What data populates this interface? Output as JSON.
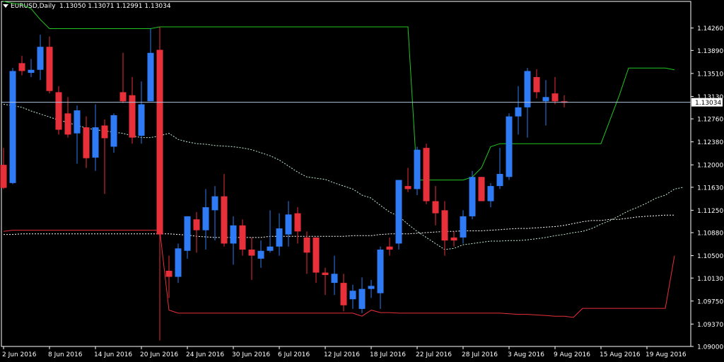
{
  "header": {
    "symbol": "EURUSD,Daily",
    "ohlc": "1.13050 1.13071 1.12991 1.13034"
  },
  "colors": {
    "background": "#000000",
    "bull": "#2f7bf5",
    "bear": "#e8303a",
    "upper_band": "#21c521",
    "lower_band": "#e8303a",
    "ma_long": "#ffffff",
    "ma_short": "#c8f0d8",
    "frame": "#ffffff",
    "current_price_line": "#b0c4de"
  },
  "chart_data": {
    "type": "candlestick",
    "title": "",
    "ylim": [
      1.09,
      1.147
    ],
    "y_ticks": [
      "1.14260",
      "1.13890",
      "1.13510",
      "1.13130",
      "1.12760",
      "1.12380",
      "1.12000",
      "1.11630",
      "1.11250",
      "1.10880",
      "1.10500",
      "1.10130",
      "1.09750",
      "1.09370",
      "1.09000"
    ],
    "current_price_label": "1.13034",
    "current_price": 1.13034,
    "x_labels": [
      {
        "bar": 0,
        "label": "2 Jun 2016"
      },
      {
        "bar": 5,
        "label": "8 Jun 2016"
      },
      {
        "bar": 10,
        "label": "14 Jun 2016"
      },
      {
        "bar": 15,
        "label": "20 Jun 2016"
      },
      {
        "bar": 20,
        "label": "24 Jun 2016"
      },
      {
        "bar": 25,
        "label": "30 Jun 2016"
      },
      {
        "bar": 30,
        "label": "6 Jul 2016"
      },
      {
        "bar": 35,
        "label": "12 Jul 2016"
      },
      {
        "bar": 40,
        "label": "18 Jul 2016"
      },
      {
        "bar": 45,
        "label": "22 Jul 2016"
      },
      {
        "bar": 50,
        "label": "28 Jul 2016"
      },
      {
        "bar": 55,
        "label": "3 Aug 2016"
      },
      {
        "bar": 60,
        "label": "9 Aug 2016"
      },
      {
        "bar": 65,
        "label": "15 Aug 2016"
      },
      {
        "bar": 70,
        "label": "19 Aug 2016"
      }
    ],
    "candles": [
      {
        "o": 1.12,
        "h": 1.1228,
        "l": 1.116,
        "c": 1.1162
      },
      {
        "o": 1.117,
        "h": 1.136,
        "l": 1.1168,
        "c": 1.1355
      },
      {
        "o": 1.1368,
        "h": 1.138,
        "l": 1.1348,
        "c": 1.1355
      },
      {
        "o": 1.1352,
        "h": 1.1375,
        "l": 1.1345,
        "c": 1.1357
      },
      {
        "o": 1.1357,
        "h": 1.1415,
        "l": 1.134,
        "c": 1.1395
      },
      {
        "o": 1.1395,
        "h": 1.1412,
        "l": 1.1318,
        "c": 1.1322
      },
      {
        "o": 1.132,
        "h": 1.133,
        "l": 1.125,
        "c": 1.1258
      },
      {
        "o": 1.1285,
        "h": 1.1312,
        "l": 1.1245,
        "c": 1.125
      },
      {
        "o": 1.1252,
        "h": 1.1298,
        "l": 1.1202,
        "c": 1.129
      },
      {
        "o": 1.1262,
        "h": 1.128,
        "l": 1.1195,
        "c": 1.1211
      },
      {
        "o": 1.1212,
        "h": 1.13,
        "l": 1.119,
        "c": 1.1262
      },
      {
        "o": 1.1265,
        "h": 1.1275,
        "l": 1.1152,
        "c": 1.1244
      },
      {
        "o": 1.123,
        "h": 1.1285,
        "l": 1.122,
        "c": 1.1282
      },
      {
        "o": 1.132,
        "h": 1.1385,
        "l": 1.1302,
        "c": 1.1305
      },
      {
        "o": 1.1315,
        "h": 1.1345,
        "l": 1.1235,
        "c": 1.1245
      },
      {
        "o": 1.1248,
        "h": 1.1338,
        "l": 1.1235,
        "c": 1.13
      },
      {
        "o": 1.1305,
        "h": 1.1425,
        "l": 1.1315,
        "c": 1.1385
      },
      {
        "o": 1.139,
        "h": 1.1428,
        "l": 1.091,
        "c": 1.1085
      },
      {
        "o": 1.1025,
        "h": 1.105,
        "l": 1.098,
        "c": 1.1015
      },
      {
        "o": 1.1015,
        "h": 1.107,
        "l": 1.1005,
        "c": 1.1062
      },
      {
        "o": 1.1058,
        "h": 1.1115,
        "l": 1.1045,
        "c": 1.1115
      },
      {
        "o": 1.111,
        "h": 1.1122,
        "l": 1.1055,
        "c": 1.1092
      },
      {
        "o": 1.1092,
        "h": 1.116,
        "l": 1.106,
        "c": 1.113
      },
      {
        "o": 1.1125,
        "h": 1.1165,
        "l": 1.1075,
        "c": 1.1148
      },
      {
        "o": 1.1148,
        "h": 1.1185,
        "l": 1.1065,
        "c": 1.107
      },
      {
        "o": 1.107,
        "h": 1.1115,
        "l": 1.1035,
        "c": 1.11
      },
      {
        "o": 1.11,
        "h": 1.111,
        "l": 1.105,
        "c": 1.106
      },
      {
        "o": 1.106,
        "h": 1.108,
        "l": 1.101,
        "c": 1.105
      },
      {
        "o": 1.1045,
        "h": 1.1075,
        "l": 1.103,
        "c": 1.1058
      },
      {
        "o": 1.1058,
        "h": 1.1125,
        "l": 1.1055,
        "c": 1.1065
      },
      {
        "o": 1.1065,
        "h": 1.112,
        "l": 1.105,
        "c": 1.1095
      },
      {
        "o": 1.1085,
        "h": 1.114,
        "l": 1.1065,
        "c": 1.1118
      },
      {
        "o": 1.112,
        "h": 1.113,
        "l": 1.107,
        "c": 1.109
      },
      {
        "o": 1.108,
        "h": 1.109,
        "l": 1.102,
        "c": 1.1055
      },
      {
        "o": 1.108,
        "h": 1.108,
        "l": 1.1005,
        "c": 1.1022
      },
      {
        "o": 1.1022,
        "h": 1.103,
        "l": 1.0985,
        "c": 1.1018
      },
      {
        "o": 1.1005,
        "h": 1.105,
        "l": 1.0985,
        "c": 1.102
      },
      {
        "o": 1.1005,
        "h": 1.102,
        "l": 1.0958,
        "c": 1.0968
      },
      {
        "o": 1.0978,
        "h": 1.1002,
        "l": 1.0962,
        "c": 1.0992
      },
      {
        "o": 1.0962,
        "h": 1.1014,
        "l": 1.0955,
        "c": 1.0995
      },
      {
        "o": 1.0995,
        "h": 1.101,
        "l": 1.098,
        "c": 1.1
      },
      {
        "o": 1.0988,
        "h": 1.1065,
        "l": 1.0962,
        "c": 1.106
      },
      {
        "o": 1.1065,
        "h": 1.108,
        "l": 1.105,
        "c": 1.106
      },
      {
        "o": 1.107,
        "h": 1.1175,
        "l": 1.106,
        "c": 1.1175
      },
      {
        "o": 1.1165,
        "h": 1.1195,
        "l": 1.1155,
        "c": 1.116
      },
      {
        "o": 1.116,
        "h": 1.123,
        "l": 1.115,
        "c": 1.1225
      },
      {
        "o": 1.1228,
        "h": 1.1235,
        "l": 1.1135,
        "c": 1.114
      },
      {
        "o": 1.114,
        "h": 1.1165,
        "l": 1.11,
        "c": 1.112
      },
      {
        "o": 1.1125,
        "h": 1.114,
        "l": 1.105,
        "c": 1.1075
      },
      {
        "o": 1.108,
        "h": 1.109,
        "l": 1.1065,
        "c": 1.1075
      },
      {
        "o": 1.108,
        "h": 1.1125,
        "l": 1.107,
        "c": 1.1115
      },
      {
        "o": 1.1115,
        "h": 1.119,
        "l": 1.111,
        "c": 1.118
      },
      {
        "o": 1.118,
        "h": 1.118,
        "l": 1.114,
        "c": 1.114
      },
      {
        "o": 1.114,
        "h": 1.117,
        "l": 1.113,
        "c": 1.1165
      },
      {
        "o": 1.1165,
        "h": 1.1228,
        "l": 1.116,
        "c": 1.1185
      },
      {
        "o": 1.118,
        "h": 1.1285,
        "l": 1.1175,
        "c": 1.128
      },
      {
        "o": 1.128,
        "h": 1.133,
        "l": 1.125,
        "c": 1.1295
      },
      {
        "o": 1.1295,
        "h": 1.136,
        "l": 1.1245,
        "c": 1.1355
      },
      {
        "o": 1.1345,
        "h": 1.1358,
        "l": 1.131,
        "c": 1.132
      },
      {
        "o": 1.1305,
        "h": 1.134,
        "l": 1.1265,
        "c": 1.1312
      },
      {
        "o": 1.1318,
        "h": 1.1345,
        "l": 1.13,
        "c": 1.1305
      },
      {
        "o": 1.1305,
        "h": 1.1315,
        "l": 1.1295,
        "c": 1.1303
      }
    ],
    "lines": {
      "upper_band": [
        1.147,
        1.1467,
        1.1465,
        1.1458,
        1.144,
        1.1425,
        1.1425,
        1.1425,
        1.1425,
        1.1425,
        1.1425,
        1.1425,
        1.1425,
        1.1425,
        1.1425,
        1.1425,
        1.1425,
        1.1428,
        1.1428,
        1.1428,
        1.1428,
        1.1428,
        1.1428,
        1.1428,
        1.1428,
        1.1428,
        1.1428,
        1.1428,
        1.1428,
        1.1428,
        1.1428,
        1.1428,
        1.1428,
        1.1428,
        1.1428,
        1.1428,
        1.1428,
        1.1428,
        1.1428,
        1.1428,
        1.1428,
        1.1428,
        1.1428,
        1.1428,
        1.1428,
        1.1175,
        1.1175,
        1.1175,
        1.1175,
        1.1175,
        1.1175,
        1.118,
        1.1195,
        1.123,
        1.1235,
        1.1235,
        1.1235,
        1.1235,
        1.1235,
        1.1235,
        1.1235,
        1.1235,
        1.1235,
        1.1235,
        1.1235,
        1.1235,
        1.1275,
        1.1315,
        1.136,
        1.136,
        1.136,
        1.136,
        1.136,
        1.1357
      ],
      "lower_band": [
        1.109,
        1.1092,
        1.1092,
        1.1092,
        1.1092,
        1.1092,
        1.1092,
        1.1092,
        1.1092,
        1.1092,
        1.1092,
        1.1092,
        1.1092,
        1.1092,
        1.1092,
        1.1092,
        1.1092,
        1.1092,
        1.096,
        1.0955,
        1.0955,
        1.0955,
        1.0955,
        1.0955,
        1.0955,
        1.0955,
        1.0955,
        1.0955,
        1.0955,
        1.0955,
        1.0955,
        1.0955,
        1.0955,
        1.0955,
        1.0955,
        1.0955,
        1.0955,
        1.0955,
        1.0955,
        1.095,
        1.096,
        1.0956,
        1.0956,
        1.0955,
        1.0955,
        1.0955,
        1.0955,
        1.0955,
        1.0955,
        1.0955,
        1.0955,
        1.0955,
        1.0955,
        1.0955,
        1.0955,
        1.0954,
        1.0953,
        1.0953,
        1.0952,
        1.0951,
        1.095,
        1.095,
        1.0948,
        1.0963,
        1.0963,
        1.0963,
        1.0963,
        1.0963,
        1.0963,
        1.0963,
        1.0963,
        1.0963,
        1.0963,
        1.105
      ],
      "ma_long": [
        1.1085,
        1.1085,
        1.1086,
        1.1086,
        1.1086,
        1.1086,
        1.1086,
        1.1086,
        1.1086,
        1.1086,
        1.1086,
        1.1086,
        1.1086,
        1.1086,
        1.1086,
        1.1086,
        1.1086,
        1.1086,
        1.1086,
        1.1085,
        1.1084,
        1.1082,
        1.1081,
        1.108,
        1.108,
        1.108,
        1.108,
        1.108,
        1.108,
        1.1082,
        1.1082,
        1.1082,
        1.1082,
        1.1082,
        1.1082,
        1.1082,
        1.1082,
        1.1082,
        1.1083,
        1.1083,
        1.1083,
        1.1085,
        1.1086,
        1.1086,
        1.1086,
        1.1087,
        1.1088,
        1.1089,
        1.109,
        1.109,
        1.1091,
        1.1091,
        1.1091,
        1.1092,
        1.1093,
        1.1094,
        1.1095,
        1.1095,
        1.1096,
        1.1097,
        1.1098,
        1.11,
        1.1103,
        1.1106,
        1.1108,
        1.1108,
        1.111,
        1.111,
        1.1112,
        1.1114,
        1.1115,
        1.1116,
        1.1117,
        1.1117
      ],
      "ma_short": [
        1.13,
        1.1298,
        1.1295,
        1.1289,
        1.1284,
        1.1279,
        1.1274,
        1.127,
        1.1265,
        1.1261,
        1.1258,
        1.1256,
        1.1254,
        1.1252,
        1.1248,
        1.1245,
        1.1245,
        1.1248,
        1.1252,
        1.1242,
        1.1238,
        1.1235,
        1.1234,
        1.1232,
        1.1231,
        1.123,
        1.1228,
        1.1225,
        1.122,
        1.1215,
        1.1208,
        1.1198,
        1.1188,
        1.118,
        1.1178,
        1.1176,
        1.117,
        1.1165,
        1.116,
        1.115,
        1.1145,
        1.1133,
        1.1122,
        1.1115,
        1.1102,
        1.109,
        1.108,
        1.107,
        1.106,
        1.1062,
        1.1068,
        1.107,
        1.1072,
        1.1074,
        1.1074,
        1.1075,
        1.1075,
        1.1076,
        1.1078,
        1.108,
        1.1083,
        1.1085,
        1.1088,
        1.109,
        1.1095,
        1.1102,
        1.1108,
        1.1116,
        1.1124,
        1.113,
        1.1137,
        1.1145,
        1.115,
        1.116,
        1.1163
      ]
    }
  }
}
